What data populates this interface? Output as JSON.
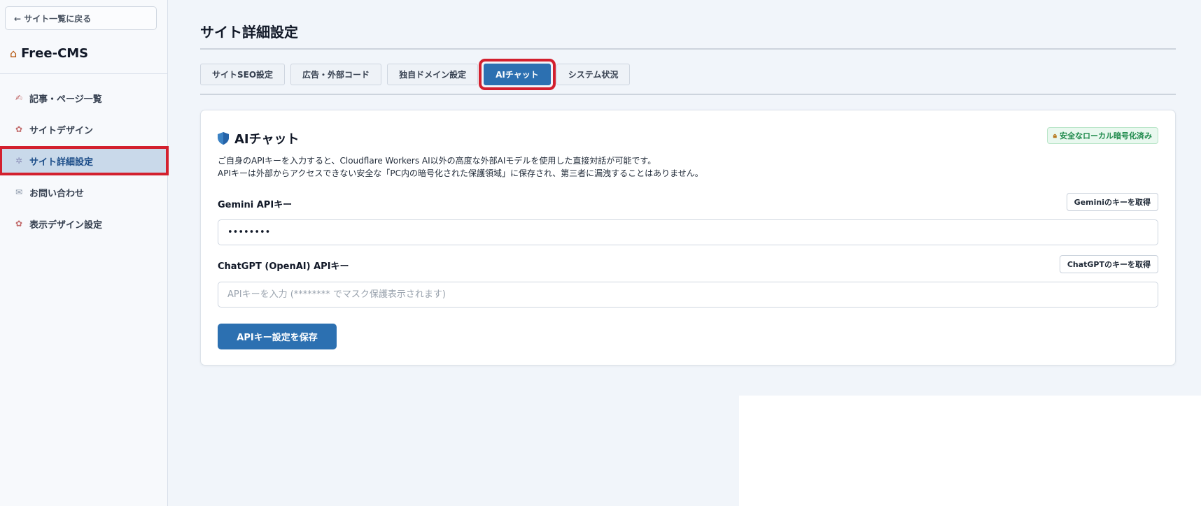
{
  "sidebar": {
    "back_label": "← サイト一覧に戻る",
    "brand_name": "Free-CMS",
    "items": [
      {
        "label": "記事・ページ一覧",
        "icon": "writing-hand-icon"
      },
      {
        "label": "サイトデザイン",
        "icon": "palette-icon"
      },
      {
        "label": "サイト詳細設定",
        "icon": "gear-icon"
      },
      {
        "label": "お問い合わせ",
        "icon": "mail-icon"
      },
      {
        "label": "表示デザイン設定",
        "icon": "palette-icon"
      }
    ]
  },
  "main": {
    "page_title": "サイト詳細設定",
    "tabs": [
      {
        "label": "サイトSEO設定"
      },
      {
        "label": "広告・外部コード"
      },
      {
        "label": "独自ドメイン設定"
      },
      {
        "label": "AIチャット"
      },
      {
        "label": "システム状況"
      }
    ],
    "card": {
      "title": "AIチャット",
      "badge": "安全なローカル暗号化済み",
      "desc_line1": "ご自身のAPIキーを入力すると、Cloudflare Workers AI以外の高度な外部AIモデルを使用した直接対話が可能です。",
      "desc_line2": "APIキーは外部からアクセスできない安全な「PC内の暗号化された保護領域」に保存され、第三者に漏洩することはありません。",
      "gemini_label": "Gemini APIキー",
      "gemini_btn": "Geminiのキーを取得",
      "gemini_value": "••••••••",
      "chatgpt_label": "ChatGPT (OpenAI) APIキー",
      "chatgpt_btn": "ChatGPTのキーを取得",
      "chatgpt_placeholder": "APIキーを入力 (******** でマスク保護表示されます)",
      "save_label": "APIキー設定を保存"
    }
  },
  "colors": {
    "accent": "#2c70b1",
    "highlight": "#d3202e",
    "badge_text": "#1f8a4c"
  }
}
